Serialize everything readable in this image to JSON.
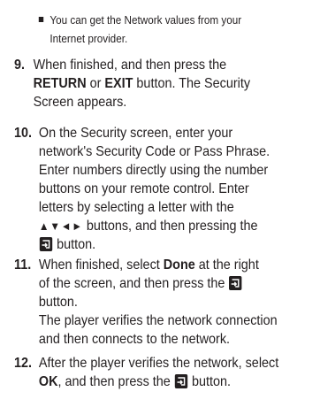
{
  "note": {
    "line1": "You can get the Network values from your",
    "line2": "Internet provider."
  },
  "steps": [
    {
      "number": "9.",
      "lines": [
        "When finished, and then press the",
        [
          "RETURN",
          " or ",
          "EXIT",
          " button. The Security"
        ],
        "Screen appears."
      ]
    },
    {
      "number": "10.",
      "lines": [
        "On the Security screen, enter your",
        "network's Security Code or Pass Phrase.",
        "Enter numbers directly using the number",
        "buttons on your remote control. Enter",
        "letters by selecting a letter with the",
        [
          "▲▼◄►",
          " buttons, and then pressing the"
        ],
        "button."
      ]
    },
    {
      "number": "11.",
      "lines": [
        [
          "When finished, select ",
          "Done",
          " at the right"
        ],
        "of the screen, and then press the",
        "button.",
        "The player verifies the network connection",
        "and then connects to the network."
      ]
    },
    {
      "number": "12.",
      "lines": [
        "After the player verifies the network, select",
        [
          "OK",
          ", and then press the ",
          "button."
        ]
      ]
    }
  ],
  "icons": {
    "enter": "enter-button-icon"
  }
}
